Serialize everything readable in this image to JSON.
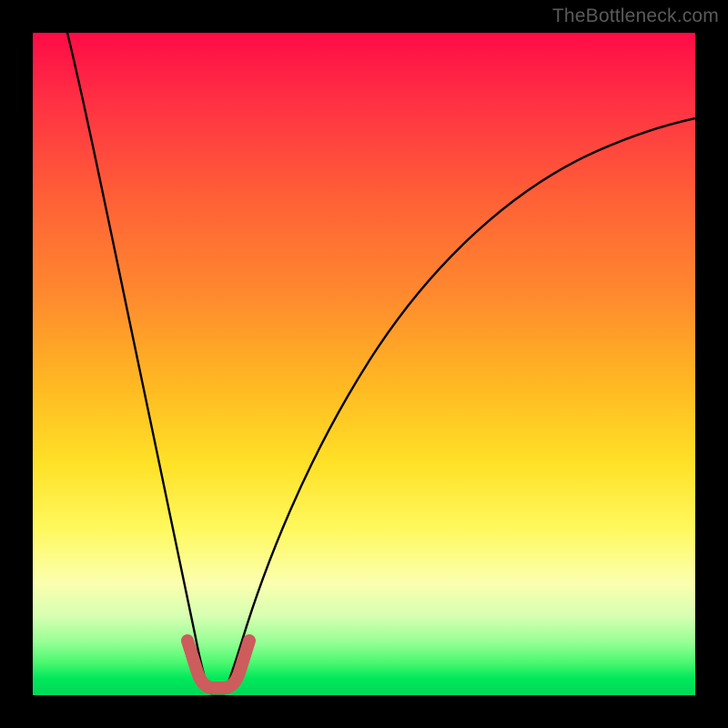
{
  "watermark": "TheBottleneck.com",
  "chart_data": {
    "type": "line",
    "title": "",
    "xlabel": "",
    "ylabel": "",
    "xlim": [
      0,
      100
    ],
    "ylim": [
      0,
      100
    ],
    "grid": false,
    "series": [
      {
        "name": "bottleneck-curve-left",
        "x": [
          5,
          7,
          9,
          11,
          13,
          15,
          17,
          19,
          21,
          23,
          24,
          25,
          26
        ],
        "values": [
          100,
          90,
          80,
          70,
          60,
          50,
          40,
          30,
          20,
          10,
          5,
          2,
          0
        ]
      },
      {
        "name": "bottleneck-curve-right",
        "x": [
          29,
          30,
          31,
          33,
          36,
          40,
          45,
          50,
          56,
          63,
          71,
          80,
          90,
          100
        ],
        "values": [
          0,
          2,
          5,
          10,
          18,
          27,
          36,
          44,
          52,
          59,
          66,
          72,
          78,
          83
        ]
      },
      {
        "name": "optimal-zone-marker",
        "x": [
          23,
          24,
          25,
          26,
          27,
          28,
          29,
          30,
          31,
          32
        ],
        "values": [
          8,
          4,
          2,
          0.5,
          0,
          0,
          0.5,
          2,
          4,
          8
        ]
      }
    ],
    "optimum_x": 27.5,
    "colors": {
      "curve": "#000000",
      "marker": "#cd5c5c",
      "gradient_top": "#ff0b46",
      "gradient_bottom": "#00d858"
    }
  }
}
